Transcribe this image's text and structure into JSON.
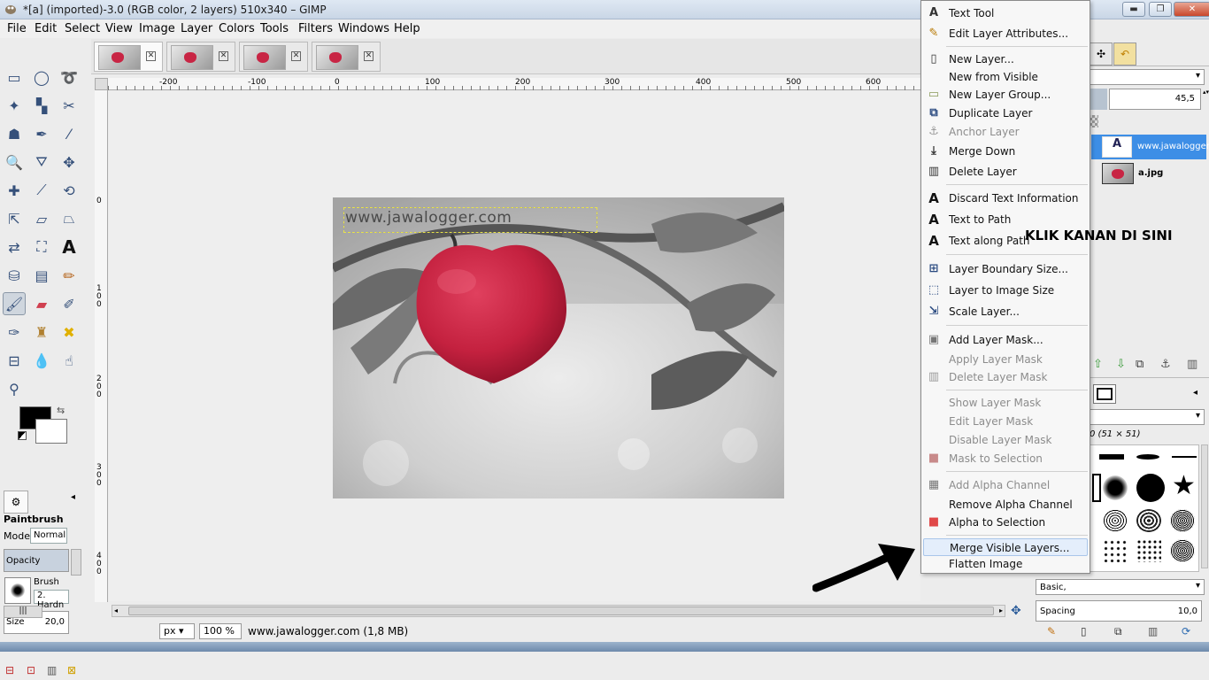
{
  "window": {
    "title": "*[a] (imported)-3.0 (RGB color, 2 layers) 510x340 – GIMP",
    "min_label": "▬",
    "max_label": "❐",
    "close_label": "✕"
  },
  "menubar": [
    "File",
    "Edit",
    "Select",
    "View",
    "Image",
    "Layer",
    "Colors",
    "Tools",
    "Filters",
    "Windows",
    "Help"
  ],
  "image_tabs": {
    "close_glyph": "✕"
  },
  "rulers": {
    "top_labels": [
      "-200",
      "-100",
      "0",
      "100",
      "200",
      "300",
      "400",
      "500",
      "600"
    ],
    "left_labels": [
      "0",
      "100",
      "200",
      "300",
      "400"
    ]
  },
  "canvas": {
    "watermark": "www.jawalogger.com",
    "accent_color": "#c82544"
  },
  "tool_options": {
    "tool_name": "Paintbrush",
    "mode_label": "Mode:",
    "mode_value": "Normal",
    "opacity_label": "Opacity",
    "brush_label": "Brush",
    "brush_value": "2. Hardn",
    "size_label": "Size",
    "size_value": "20,0"
  },
  "statusbar": {
    "unit": "px",
    "zoom": "100 %",
    "text": "www.jawalogger.com (1,8 MB)"
  },
  "dock": {
    "opacity_value": "45,5",
    "layers": [
      {
        "name": "www.jawalogger.",
        "selected": true
      },
      {
        "name": "a.jpg",
        "selected": false
      }
    ],
    "brush_size_label": "0 (51 × 51)",
    "brush_preset": "Basic,",
    "spacing_label": "Spacing",
    "spacing_value": "10,0"
  },
  "context_menu": {
    "items": [
      {
        "label": "Text Tool",
        "icon": "A",
        "icon_name": "text-tool-icon",
        "disabled": false
      },
      {
        "label": "Edit Layer Attributes...",
        "icon": "✎",
        "icon_name": "edit-attributes-icon",
        "disabled": false
      },
      {
        "label": "New Layer...",
        "icon": "▯",
        "icon_name": "new-layer-icon",
        "disabled": false
      },
      {
        "label": "New from Visible",
        "icon": "",
        "icon_name": "new-from-visible-icon",
        "disabled": false
      },
      {
        "label": "New Layer Group...",
        "icon": "▭",
        "icon_name": "folder-icon",
        "disabled": false
      },
      {
        "label": "Duplicate Layer",
        "icon": "⧉",
        "icon_name": "duplicate-icon",
        "disabled": false
      },
      {
        "label": "Anchor Layer",
        "icon": "⚓",
        "icon_name": "anchor-icon",
        "disabled": true
      },
      {
        "label": "Merge Down",
        "icon": "⤓",
        "icon_name": "merge-down-icon",
        "disabled": false
      },
      {
        "label": "Delete Layer",
        "icon": "▥",
        "icon_name": "trash-icon",
        "disabled": false
      },
      {
        "label": "Discard Text Information",
        "icon": "A",
        "icon_name": "discard-text-icon",
        "disabled": false
      },
      {
        "label": "Text to Path",
        "icon": "A",
        "icon_name": "text-to-path-icon",
        "disabled": false
      },
      {
        "label": "Text along Path",
        "icon": "A",
        "icon_name": "text-along-path-icon",
        "disabled": false
      },
      {
        "label": "Layer Boundary Size...",
        "icon": "⊞",
        "icon_name": "boundary-size-icon",
        "disabled": false
      },
      {
        "label": "Layer to Image Size",
        "icon": "⬚",
        "icon_name": "image-size-icon",
        "disabled": false
      },
      {
        "label": "Scale Layer...",
        "icon": "⇲",
        "icon_name": "scale-icon",
        "disabled": false
      },
      {
        "label": "Add Layer Mask...",
        "icon": "▣",
        "icon_name": "add-mask-icon",
        "disabled": false
      },
      {
        "label": "Apply Layer Mask",
        "icon": "",
        "icon_name": "apply-mask-icon",
        "disabled": true
      },
      {
        "label": "Delete Layer Mask",
        "icon": "▥",
        "icon_name": "delete-mask-icon",
        "disabled": true
      },
      {
        "label": "Show Layer Mask",
        "icon": "",
        "icon_name": "show-mask-icon",
        "disabled": true
      },
      {
        "label": "Edit Layer Mask",
        "icon": "",
        "icon_name": "edit-mask-icon",
        "disabled": true
      },
      {
        "label": "Disable Layer Mask",
        "icon": "",
        "icon_name": "disable-mask-icon",
        "disabled": true
      },
      {
        "label": "Mask to Selection",
        "icon": "■",
        "icon_name": "mask-selection-icon",
        "disabled": true
      },
      {
        "label": "Add Alpha Channel",
        "icon": "▦",
        "icon_name": "alpha-icon",
        "disabled": true
      },
      {
        "label": "Remove Alpha Channel",
        "icon": "",
        "icon_name": "remove-alpha-icon",
        "disabled": false
      },
      {
        "label": "Alpha to Selection",
        "icon": "■",
        "icon_name": "alpha-selection-icon",
        "disabled": false
      },
      {
        "label": "Merge Visible Layers...",
        "icon": "",
        "icon_name": "merge-visible-icon",
        "disabled": false,
        "highlighted": true
      },
      {
        "label": "Flatten Image",
        "icon": "",
        "icon_name": "flatten-icon",
        "disabled": false
      }
    ]
  },
  "annotation": "KLIK KANAN DI SINI"
}
